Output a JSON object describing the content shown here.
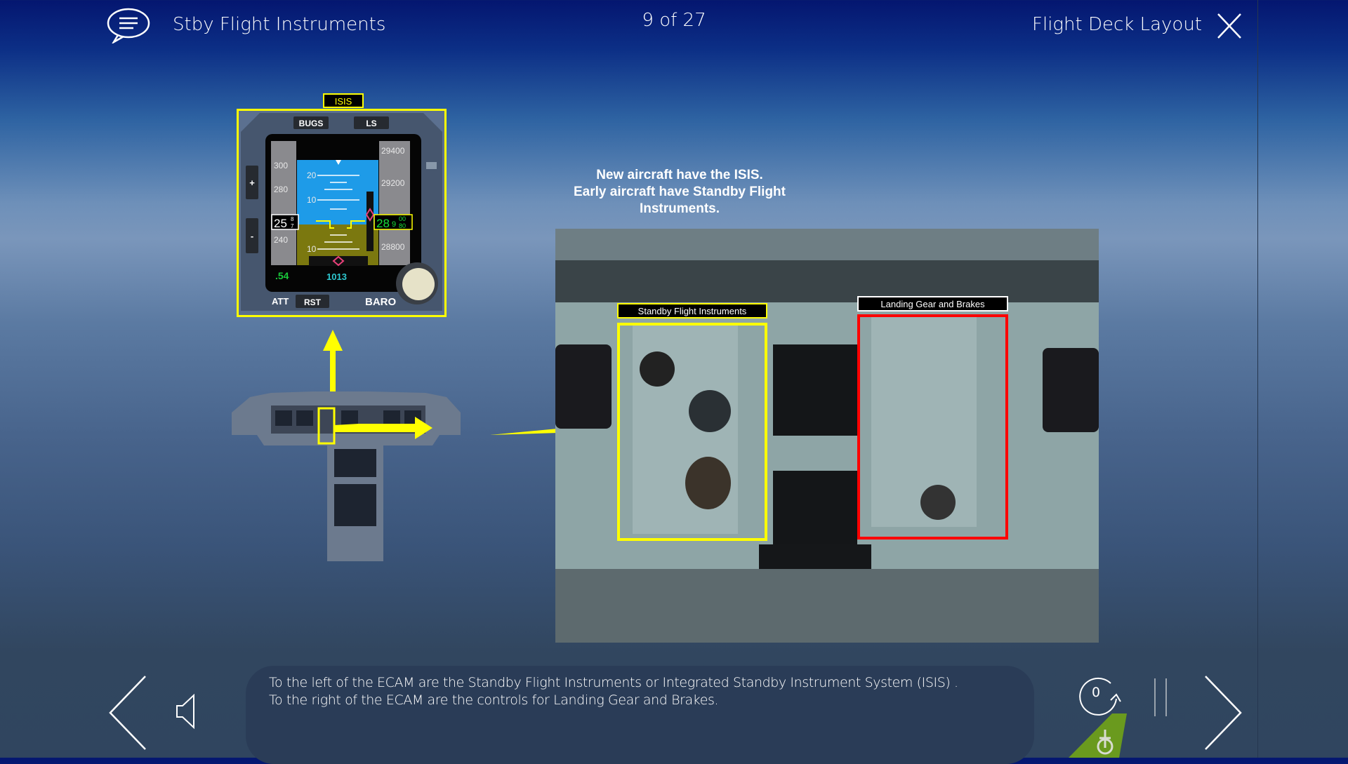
{
  "header": {
    "title": "Stby Flight Instruments",
    "progress": "9 of 27",
    "section": "Flight Deck Layout",
    "icons": {
      "notes": "speech-bubble-icon",
      "close": "close-x-icon"
    }
  },
  "isis": {
    "label": "ISIS",
    "buttons": {
      "bugs": "BUGS",
      "ls": "LS",
      "plus": "+",
      "minus": "-",
      "att": "ATT",
      "rst": "RST",
      "baro": "BARO"
    },
    "speed_ticks": [
      "300",
      "280",
      "240"
    ],
    "alt_ticks": [
      "29400",
      "29200",
      "28800"
    ],
    "pitch_ticks": [
      "20",
      "10",
      "10"
    ],
    "speed_readout": "25",
    "speed_sub": [
      "8",
      "7"
    ],
    "alt_readout": "28",
    "alt_sub": "9",
    "alt_sub2": [
      "00",
      "80"
    ],
    "mach": ".54",
    "baro_setting": "1013"
  },
  "info_text": [
    "New aircraft have the ISIS.",
    "Early aircraft have Standby Flight",
    "Instruments."
  ],
  "photo": {
    "standby_label": "Standby Flight Instruments",
    "gear_label": "Landing Gear and Brakes",
    "colors": {
      "standby": "#ffff00",
      "gear": "#ff0000"
    }
  },
  "caption": {
    "line1": "To the left of the ECAM are the Standby Flight Instruments or Integrated Standby Instrument System (ISIS) .",
    "line2": "To the right of the ECAM are the controls for Landing Gear and Brakes."
  },
  "footer": {
    "replay_count": "0",
    "icons": {
      "back": "chevron-left-icon",
      "audio": "speaker-icon",
      "replay": "replay-icon",
      "pause": "pause-icon",
      "next": "chevron-right-icon",
      "logo": "tail-logo-icon"
    }
  },
  "colors": {
    "highlight": "#ffff00",
    "arrow": "#ffff00",
    "brand_green": "#6a9a1e"
  }
}
